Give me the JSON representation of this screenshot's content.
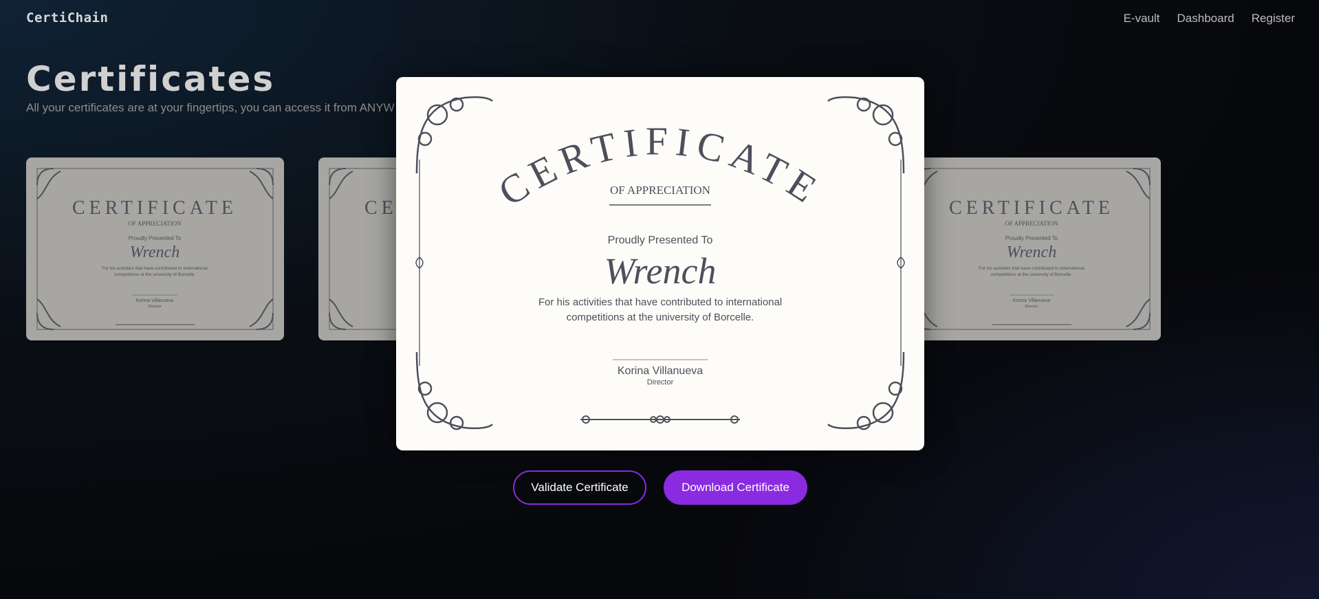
{
  "brand": "CertiChain",
  "nav": [
    {
      "label": "E-vault"
    },
    {
      "label": "Dashboard"
    },
    {
      "label": "Register"
    }
  ],
  "page": {
    "title": "Certificates",
    "subtitle": "All your certificates are at your fingertips, you can access it from ANYW"
  },
  "certificate": {
    "heading": "CERTIFICATE",
    "subheading": "OF APPRECIATION",
    "presented": "Proudly Presented To",
    "recipient": "Wrench",
    "description_line1": "For his activities that have contributed to international",
    "description_line2": "competitions at the university of Borcelle.",
    "signer_name": "Korina Villanueva",
    "signer_title": "Director"
  },
  "buttons": {
    "validate": "Validate Certificate",
    "download": "Download Certificate"
  },
  "colors": {
    "accent": "#8a2be2",
    "cert_ink": "#4e4f5c",
    "card_bg": "#a7a6a3",
    "modal_bg": "#fdfcf8"
  }
}
